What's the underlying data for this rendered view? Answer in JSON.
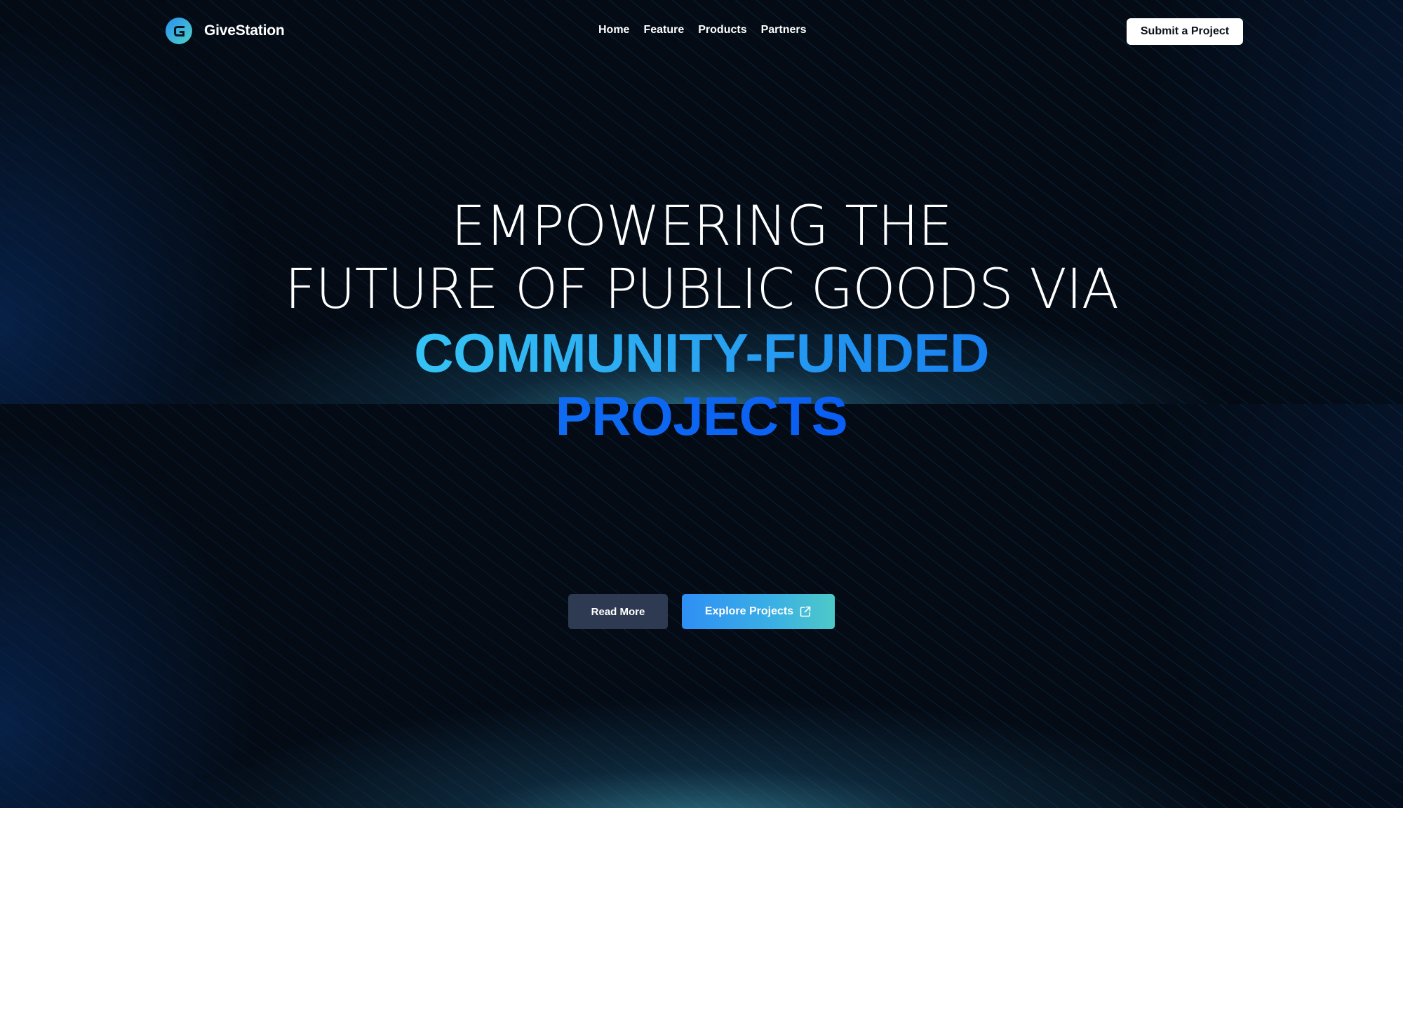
{
  "brand": {
    "name": "GiveStation",
    "logo_icon": "givestation-logo-icon"
  },
  "nav": {
    "items": [
      {
        "label": "Home"
      },
      {
        "label": "Feature"
      },
      {
        "label": "Products"
      },
      {
        "label": "Partners"
      }
    ],
    "cta_label": "Submit a Project"
  },
  "hero": {
    "line1": "EMPOWERING THE",
    "line2": "FUTURE OF PUBLIC GOODS VIA",
    "accent_line1": "COMMUNITY-FUNDED",
    "accent_line2": "PROJECTS",
    "read_more_label": "Read More",
    "explore_label": "Explore Projects",
    "explore_icon": "external-link-icon"
  },
  "colors": {
    "background": "#040b15",
    "accent_cyan": "#35c3f4",
    "accent_blue": "#0b62f2",
    "read_more_bg": "#2e3a52",
    "explore_gradient_start": "#2f8ff5",
    "explore_gradient_end": "#4ec9c8"
  }
}
